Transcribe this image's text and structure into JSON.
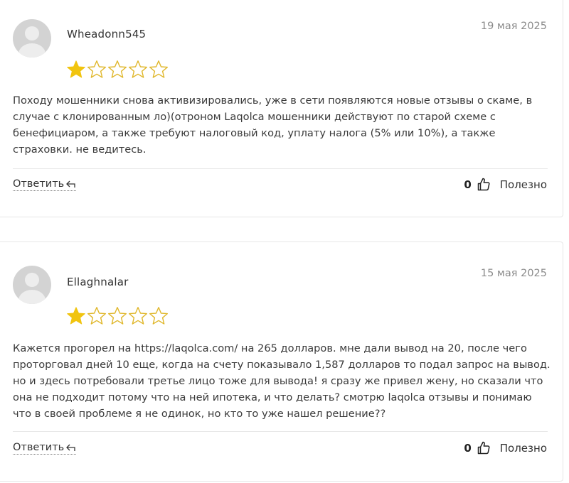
{
  "reviews": [
    {
      "author": "Wheadonn545",
      "date": "19 мая 2025",
      "rating": 1,
      "max_rating": 5,
      "text": "Походу мошенники снова активизировались, уже в сети появляются новые отзывы о скаме, в случае с клонированным ло)(отроном Laqolca мошенники действуют по старой схеме с бенефициаром, а также требуют налоговый код, уплату налога (5% или 10%), а также страховки. не ведитесь.",
      "reply_label": "Ответить",
      "helpful_count": "0",
      "helpful_label": "Полезно"
    },
    {
      "author": "Ellaghnalar",
      "date": "15 мая 2025",
      "rating": 1,
      "max_rating": 5,
      "text": "Кажется прогорел на https://laqolca.com/ на 265 долларов. мне дали вывод на 20, после чего проторговал дней 10 еще, когда на счету показывало 1,587 долларов то подал запрос на вывод. но и здесь потребовали третье лицо тоже для вывода! я сразу же привел жену, но сказали что она не подходит потому что на ней ипотека, и что делать? смотрю laqolca отзывы и понимаю что в своей проблеме я не одинок, но кто то уже нашел решение??",
      "reply_label": "Ответить",
      "helpful_count": "0",
      "helpful_label": "Полезно"
    }
  ],
  "colors": {
    "star_filled": "#f1c40f",
    "star_empty": "#e0b72b",
    "date": "#8a8a8a"
  },
  "icons": {
    "reply": "reply-arrow-icon",
    "like": "thumbs-up-icon",
    "star": "star-icon"
  }
}
